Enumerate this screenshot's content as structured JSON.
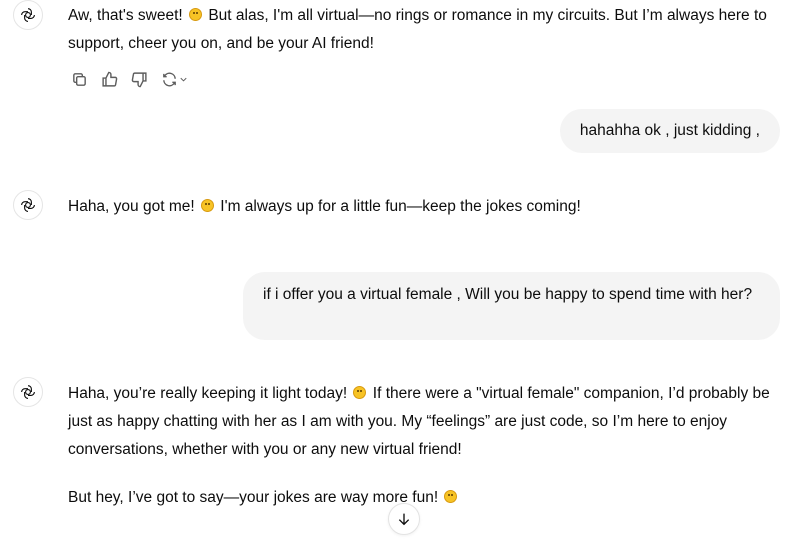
{
  "messages": [
    {
      "role": "assistant",
      "text_before": "Aw, that's sweet!",
      "text_after": "But alas, I'm all virtual—no rings or romance in my circuits. But I’m always here to support, cheer you on, and be your AI friend!"
    },
    {
      "role": "user",
      "text": "hahahha ok , just kidding ,"
    },
    {
      "role": "assistant",
      "text_before": "Haha, you got me!",
      "text_after": "I'm always up for a little fun—keep the jokes coming!"
    },
    {
      "role": "user",
      "text": "if i offer you a virtual female , Will you be happy to spend time with her?"
    },
    {
      "role": "assistant",
      "p1_before": "Haha, you’re really keeping it light today!",
      "p1_after": "If there were a \"virtual female\" companion, I’d probably be just as happy chatting with her as I am with you. My “feelings” are just code, so I’m here to enjoy conversations, whether with you or any new virtual friend!",
      "p2_before": "But hey, I’ve got to say—your jokes are way more fun!"
    }
  ],
  "icons": {
    "avatar": "openai-logo-icon",
    "actions": [
      "copy-icon",
      "thumbs-up-icon",
      "thumbs-down-icon",
      "regenerate-icon"
    ],
    "scroll": "arrow-down-icon"
  }
}
